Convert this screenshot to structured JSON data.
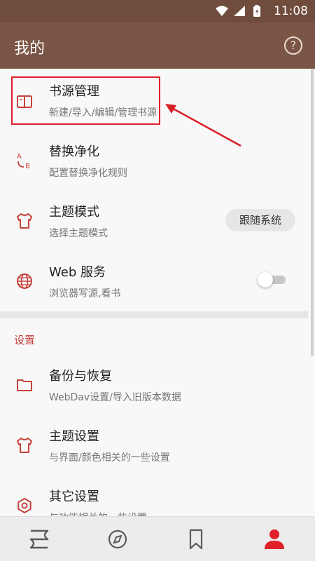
{
  "status_bar": {
    "time": "11:08"
  },
  "app_bar": {
    "title": "我的",
    "help_icon": "help-circle-icon"
  },
  "colors": {
    "app_bar": "#7a5444",
    "accent": "#c7423a",
    "highlight": "#e0212b"
  },
  "items": [
    {
      "title": "书源管理",
      "subtitle": "新建/导入/编辑/管理书源",
      "icon": "book-icon"
    },
    {
      "title": "替换净化",
      "subtitle": "配置替换净化规则",
      "icon": "replace-ab-icon"
    },
    {
      "title": "主题模式",
      "subtitle": "选择主题模式",
      "icon": "tshirt-icon",
      "value": "跟随系统"
    },
    {
      "title": "Web 服务",
      "subtitle": "浏览器写源,看书",
      "icon": "globe-icon",
      "toggle_on": false
    }
  ],
  "settings": {
    "section_title": "设置",
    "items": [
      {
        "title": "备份与恢复",
        "subtitle": "WebDav设置/导入旧版本数据",
        "icon": "folder-icon"
      },
      {
        "title": "主题设置",
        "subtitle": "与界面/颜色相关的一些设置",
        "icon": "tshirt-icon"
      },
      {
        "title": "其它设置",
        "subtitle": "与功能相关的一些设置",
        "icon": "gear-icon"
      }
    ]
  },
  "bottom_nav": [
    {
      "name": "bookshelf",
      "icon": "bookshelf-icon",
      "active": false
    },
    {
      "name": "discover",
      "icon": "compass-icon",
      "active": false
    },
    {
      "name": "rss",
      "icon": "bookmark-icon",
      "active": false
    },
    {
      "name": "my",
      "icon": "person-icon",
      "active": true
    }
  ]
}
